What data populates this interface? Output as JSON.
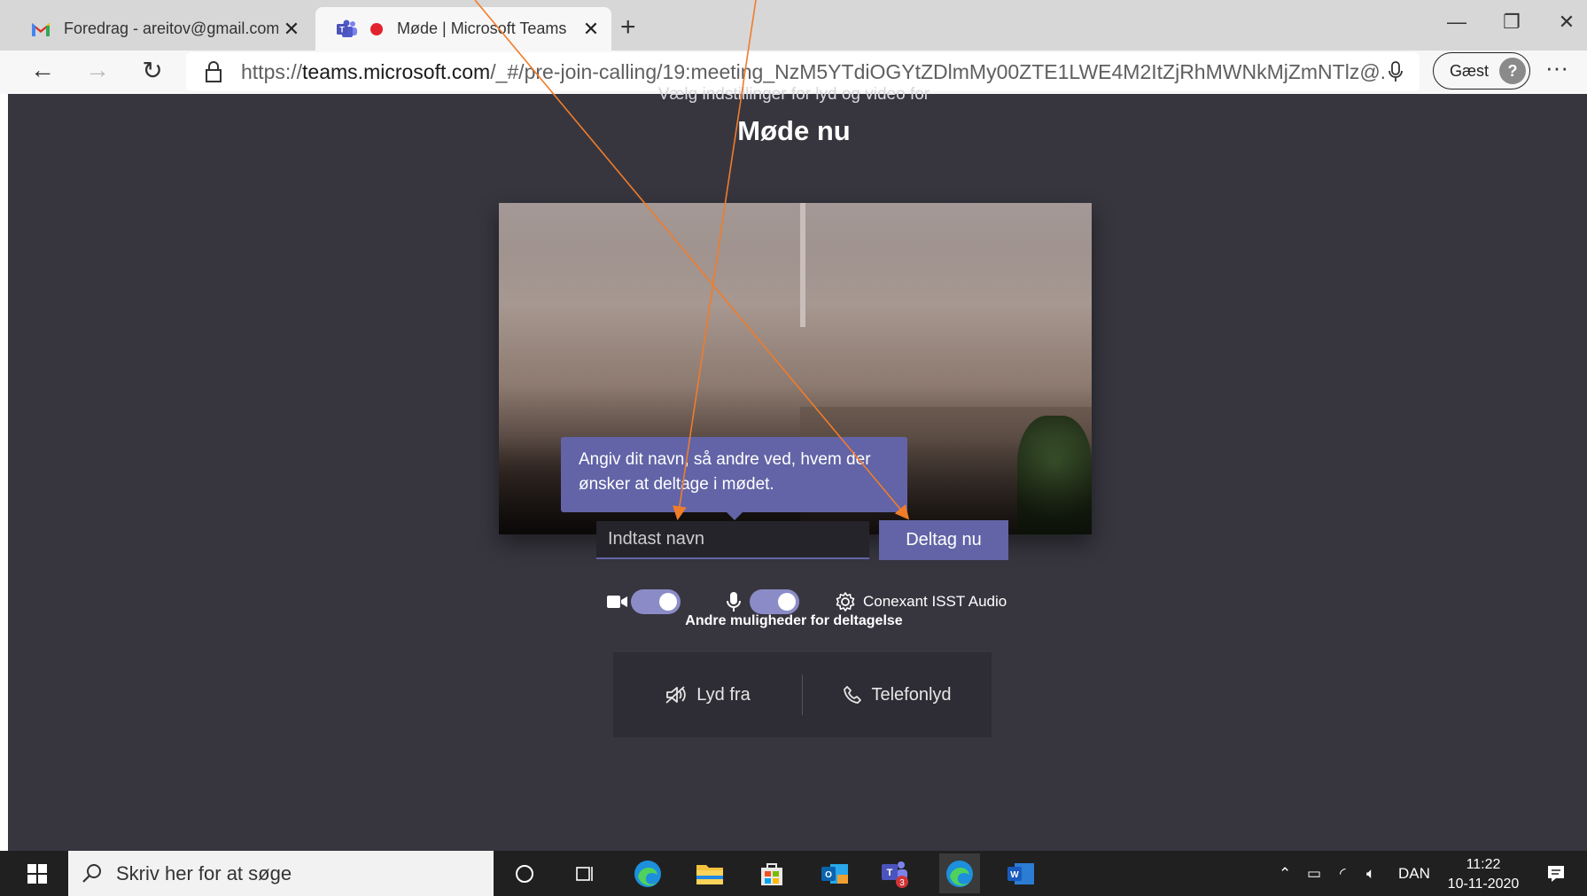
{
  "browser": {
    "tabs": [
      {
        "title": "Foredrag - areitov@gmail.com -",
        "icon": "gmail-icon",
        "active": false
      },
      {
        "title": "Møde | Microsoft Teams",
        "icon": "teams-icon",
        "active": true,
        "recording": true
      }
    ],
    "url": {
      "prefix": "https://",
      "host": "teams.microsoft.com",
      "path": "/_#/pre-join-calling/19:meeting_NzM5YTdiOGYtZDlmMy00ZTE1LWE4M2ItZjRhMWNkMjZmNTlz@..."
    },
    "profile_label": "Gæst"
  },
  "prejoin": {
    "subtitle": "Vælg indstillinger for lyd og video for",
    "meeting_title": "Møde nu",
    "tooltip": "Angiv dit navn, så andre ved, hvem der ønsker at deltage i mødet.",
    "name_placeholder": "Indtast navn",
    "join_label": "Deltag nu",
    "camera_on": true,
    "mic_on": true,
    "audio_device": "Conexant ISST Audio",
    "other_options_title": "Andre muligheder for deltagelse",
    "option_audio_off": "Lyd fra",
    "option_phone": "Telefonlyd"
  },
  "taskbar": {
    "search_placeholder": "Skriv her for at søge",
    "teams_badge": "3",
    "language": "DAN",
    "time": "11:22",
    "date": "10-11-2020"
  },
  "colors": {
    "accent": "#6264a7",
    "page_bg": "#37363f",
    "annotation": "#f07c2a"
  }
}
